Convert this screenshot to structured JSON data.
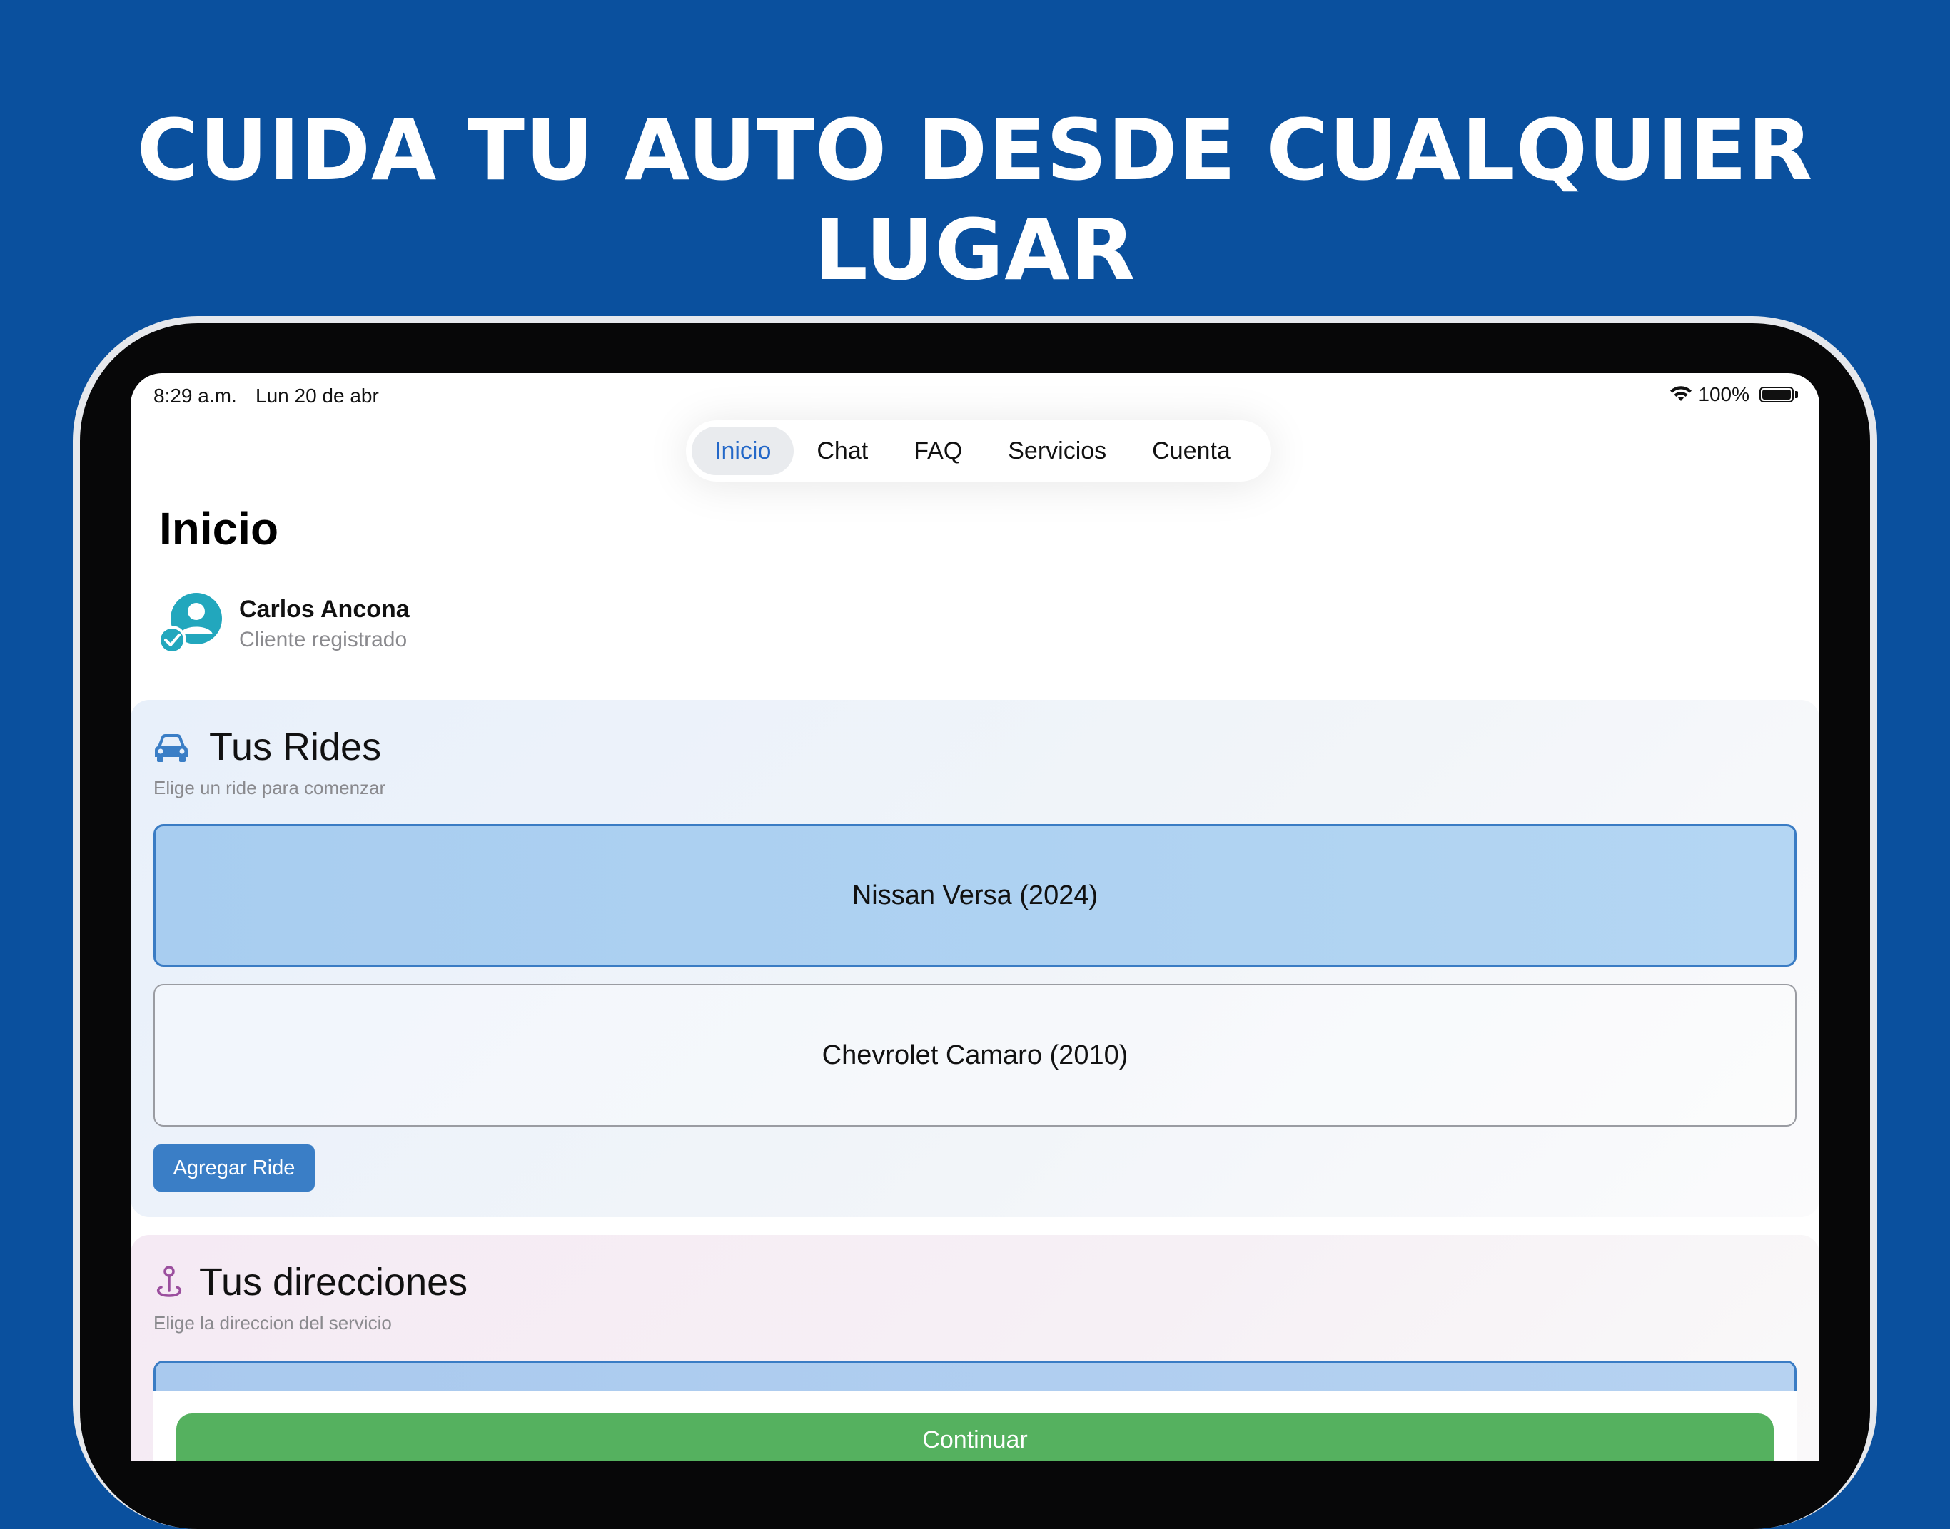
{
  "headline": "CUIDA TU AUTO DESDE CUALQUIER LUGAR",
  "status_bar": {
    "time": "8:29 a.m.",
    "date": "Lun 20 de abr",
    "battery": "100%"
  },
  "tabs": [
    {
      "label": "Inicio",
      "active": true
    },
    {
      "label": "Chat",
      "active": false
    },
    {
      "label": "FAQ",
      "active": false
    },
    {
      "label": "Servicios",
      "active": false
    },
    {
      "label": "Cuenta",
      "active": false
    }
  ],
  "page_title": "Inicio",
  "user": {
    "name": "Carlos Ancona",
    "role": "Cliente registrado",
    "icon": "verified-user-icon"
  },
  "rides_card": {
    "icon": "car-icon",
    "title": "Tus Rides",
    "subtitle": "Elige un ride para comenzar",
    "rides": [
      {
        "label": "Nissan Versa (2024)",
        "selected": true
      },
      {
        "label": "Chevrolet Camaro (2010)",
        "selected": false
      }
    ],
    "add_button": "Agregar Ride"
  },
  "addresses_card": {
    "icon": "location-pin-icon",
    "title": "Tus direcciones",
    "subtitle": "Elige la direccion del servicio"
  },
  "continue_button": "Continuar",
  "colors": {
    "background": "#0a509e",
    "accent": "#2468c8",
    "selected_fill": "#a8cdf0",
    "button_blue": "#3a7ec6",
    "continue_green": "#55b15f",
    "avatar_teal": "#22a7bd",
    "pin_purple": "#9b4f9e"
  }
}
